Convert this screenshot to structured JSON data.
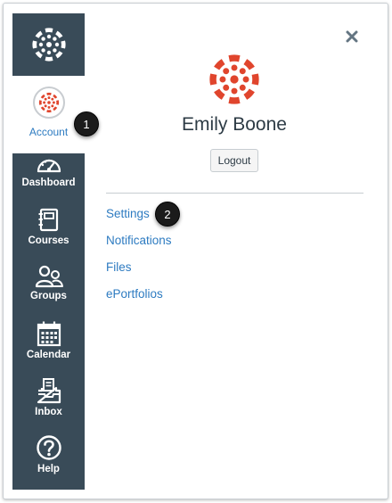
{
  "nav": {
    "account_label": "Account",
    "items": [
      {
        "label": "Dashboard",
        "icon": "dashboard-icon"
      },
      {
        "label": "Courses",
        "icon": "courses-icon"
      },
      {
        "label": "Groups",
        "icon": "groups-icon"
      },
      {
        "label": "Calendar",
        "icon": "calendar-icon"
      },
      {
        "label": "Inbox",
        "icon": "inbox-icon"
      },
      {
        "label": "Help",
        "icon": "help-icon"
      }
    ]
  },
  "callouts": {
    "one": "1",
    "two": "2"
  },
  "tray": {
    "user_name": "Emily Boone",
    "logout_label": "Logout",
    "links": [
      "Settings",
      "Notifications",
      "Files",
      "ePortfolios"
    ]
  },
  "colors": {
    "nav_bg": "#394b58",
    "brand_red": "#e0452d",
    "link_blue": "#2d7bc1",
    "text_dark": "#2d3b45"
  }
}
